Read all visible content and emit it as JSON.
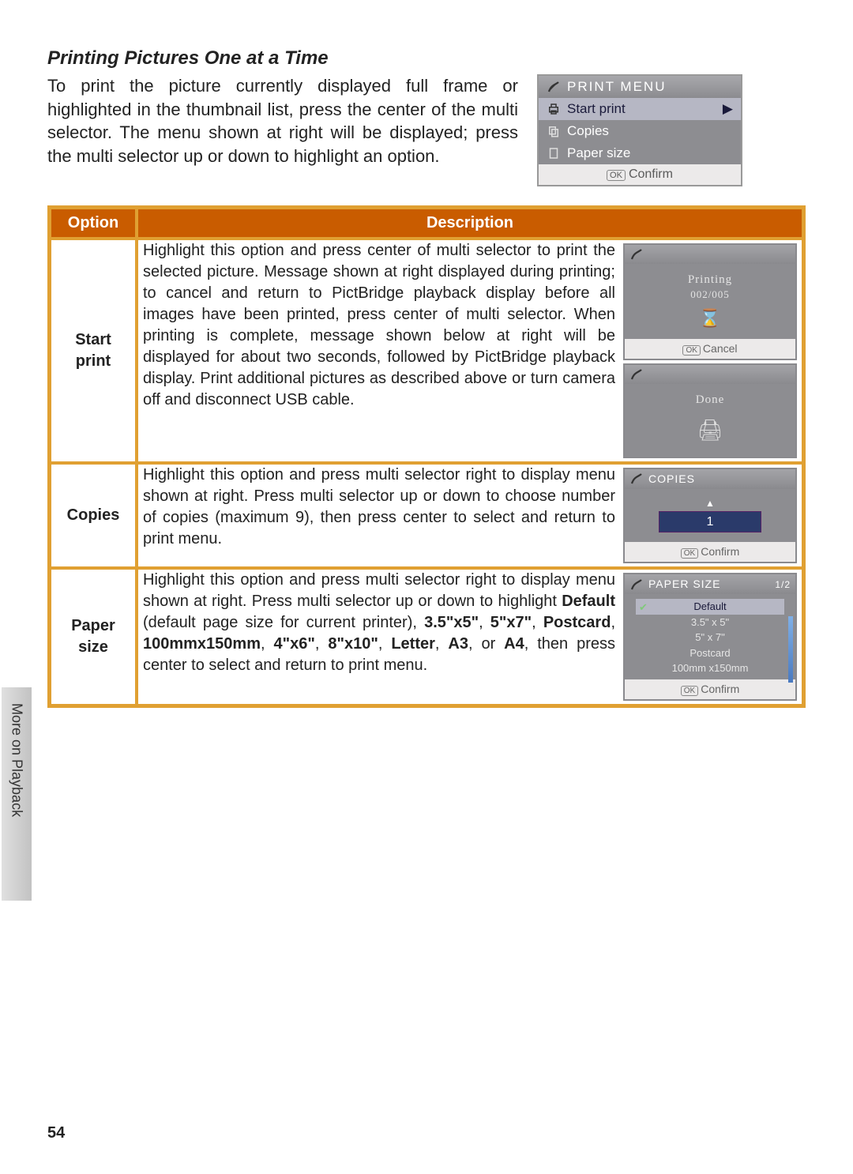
{
  "heading": "Printing Pictures One at a Time",
  "intro": "To print the picture currently displayed full frame or highlighted in the thumbnail list, press the center of the multi selector.  The menu shown at right will be displayed; press the multi selector up or down to highlight an option.",
  "print_menu": {
    "title": "PRINT MENU",
    "items": {
      "start": "Start print",
      "copies": "Copies",
      "paper": "Paper size"
    },
    "confirm": "Confirm"
  },
  "table": {
    "headers": {
      "option": "Option",
      "desc": "Description"
    },
    "start": {
      "name_line1": "Start",
      "name_line2": "print",
      "desc": "Highlight this option and press center of multi selector to print the selected picture.  Message shown at right displayed during printing; to cancel and return to PictBridge playback display before all images have been printed, press center of multi selector.  When printing is complete, message shown below at right will be displayed for about two seconds, followed by PictBridge playback display.  Print additional pictures as described above or turn camera off and disconnect USB cable.",
      "screen1": {
        "label": "Printing",
        "count": "002/005",
        "cancel": "Cancel"
      },
      "screen2": {
        "label": "Done"
      }
    },
    "copies": {
      "name": "Copies",
      "desc": "Highlight this option and press multi selector right to display menu shown at right.  Press multi selector up or down to choose number of copies (maximum 9), then press center to select and return to print menu.",
      "screen": {
        "title": "COPIES",
        "value": "1",
        "confirm": "Confirm"
      }
    },
    "paper": {
      "name_line1": "Paper",
      "name_line2": "size",
      "desc_pre": "Highlight this option and press multi selector right to display menu shown at right.  Press multi selector up or down to highlight ",
      "b1": "Default",
      "mid1": " (default page size for current printer), ",
      "b2": "3.5\"x5\"",
      "sep1": ", ",
      "b3": "5\"x7\"",
      "sep2": ", ",
      "b4": "Postcard",
      "sep3": ", ",
      "b5": "100mmx150mm",
      "sep4": ", ",
      "b6": "4\"x6\"",
      "sep5": ", ",
      "b7": "8\"x10\"",
      "sep6": ", ",
      "b8": "Letter",
      "sep7": ", ",
      "b9": "A3",
      "sep8": ", or ",
      "b10": "A4",
      "desc_post": ", then press center to select and return to print menu.",
      "screen": {
        "title": "PAPER SIZE",
        "page": "1/2",
        "items": {
          "i0": "Default",
          "i1": "3.5\" x 5\"",
          "i2": "5\" x 7\"",
          "i3": "Postcard",
          "i4": "100mm x150mm"
        },
        "confirm": "Confirm"
      }
    }
  },
  "side_tab": "More on Playback",
  "page_number": "54"
}
